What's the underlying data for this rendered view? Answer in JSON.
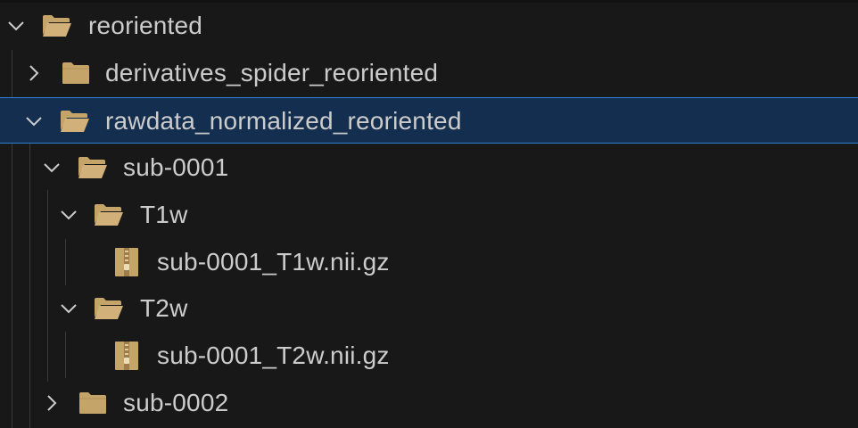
{
  "tree": {
    "root": {
      "label": "reoriented",
      "expanded": true,
      "icon": "folder-open-icon"
    },
    "items": [
      {
        "label": "derivatives_spider_reoriented",
        "expanded": false,
        "icon": "folder-icon"
      },
      {
        "label": "rawdata_normalized_reoriented",
        "expanded": true,
        "selected": true,
        "icon": "folder-open-icon",
        "children": [
          {
            "label": "sub-0001",
            "expanded": true,
            "icon": "folder-open-icon",
            "children": [
              {
                "label": "T1w",
                "expanded": true,
                "icon": "folder-open-icon",
                "children": [
                  {
                    "label": "sub-0001_T1w.nii.gz",
                    "icon": "zip-file-icon"
                  }
                ]
              },
              {
                "label": "T2w",
                "expanded": true,
                "icon": "folder-open-icon",
                "children": [
                  {
                    "label": "sub-0001_T2w.nii.gz",
                    "icon": "zip-file-icon"
                  }
                ]
              }
            ]
          },
          {
            "label": "sub-0002",
            "expanded": false,
            "icon": "folder-icon"
          }
        ]
      }
    ]
  },
  "colors": {
    "background": "#181818",
    "selection_background": "#132e4f",
    "selection_border": "#2f7fd2",
    "text": "#cccccc",
    "folder": "#c5a46a",
    "indent_guide": "#3a3a3a"
  }
}
